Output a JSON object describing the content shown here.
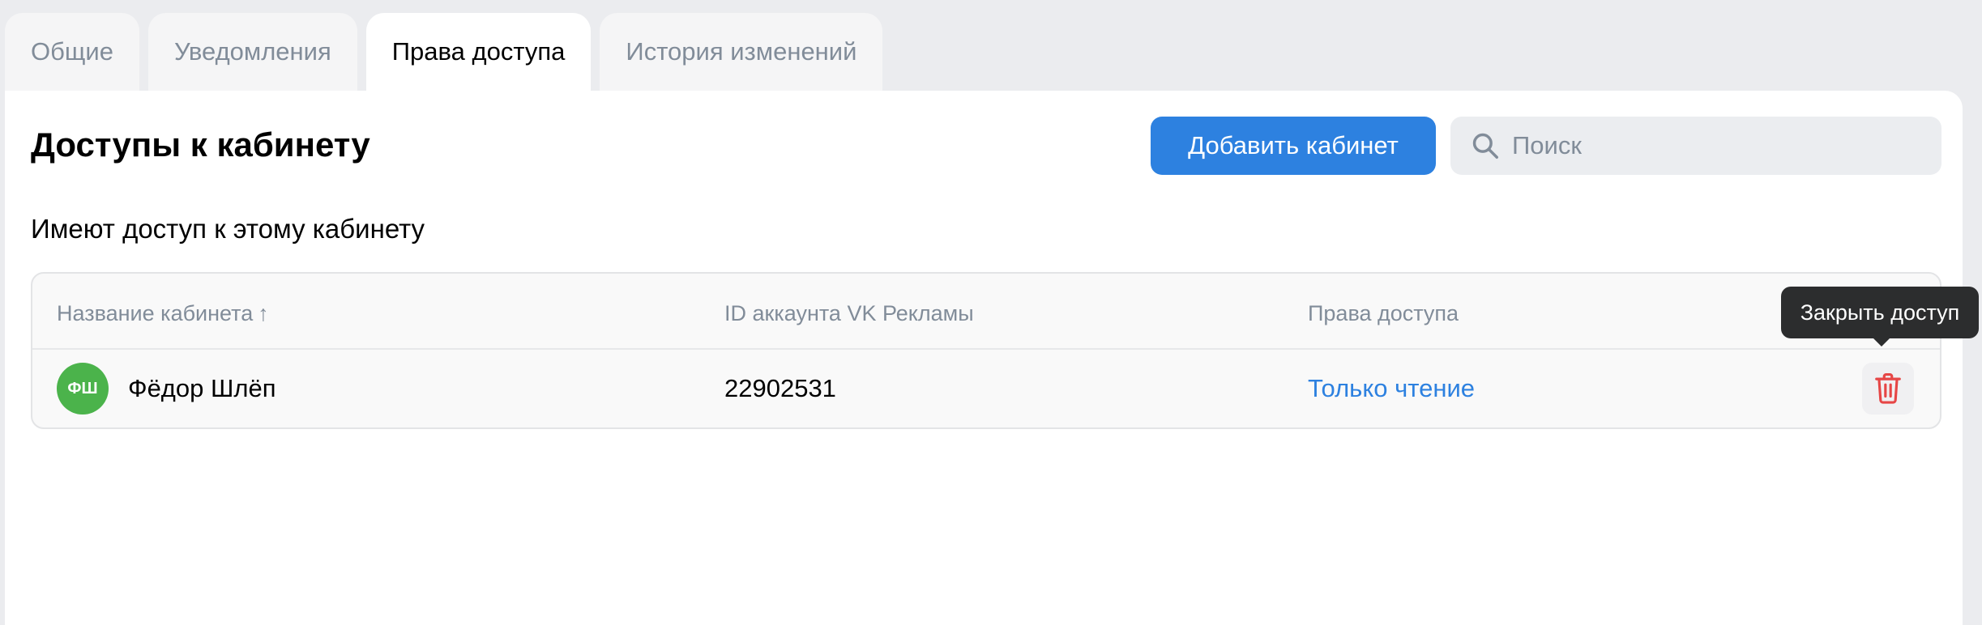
{
  "tabs": [
    {
      "label": "Общие"
    },
    {
      "label": "Уведомления"
    },
    {
      "label": "Права доступа",
      "active": true
    },
    {
      "label": "История изменений"
    }
  ],
  "header": {
    "title": "Доступы к кабинету",
    "add_button_label": "Добавить кабинет",
    "search_placeholder": "Поиск"
  },
  "section": {
    "title": "Имеют доступ к этому кабинету"
  },
  "table": {
    "columns": {
      "name": "Название кабинета",
      "name_sort": "↑",
      "account_id": "ID аккаунта VK Рекламы",
      "rights": "Права доступа"
    },
    "rows": [
      {
        "avatar_initials": "ФШ",
        "name": "Фёдор Шлёп",
        "account_id": "22902531",
        "rights": "Только чтение"
      }
    ]
  },
  "tooltip": {
    "text": "Закрыть доступ"
  },
  "icons": {
    "search": "search-icon",
    "delete": "trash-icon"
  },
  "colors": {
    "accent": "#2d81e0",
    "danger": "#e64646",
    "avatar": "#4bb34b"
  }
}
